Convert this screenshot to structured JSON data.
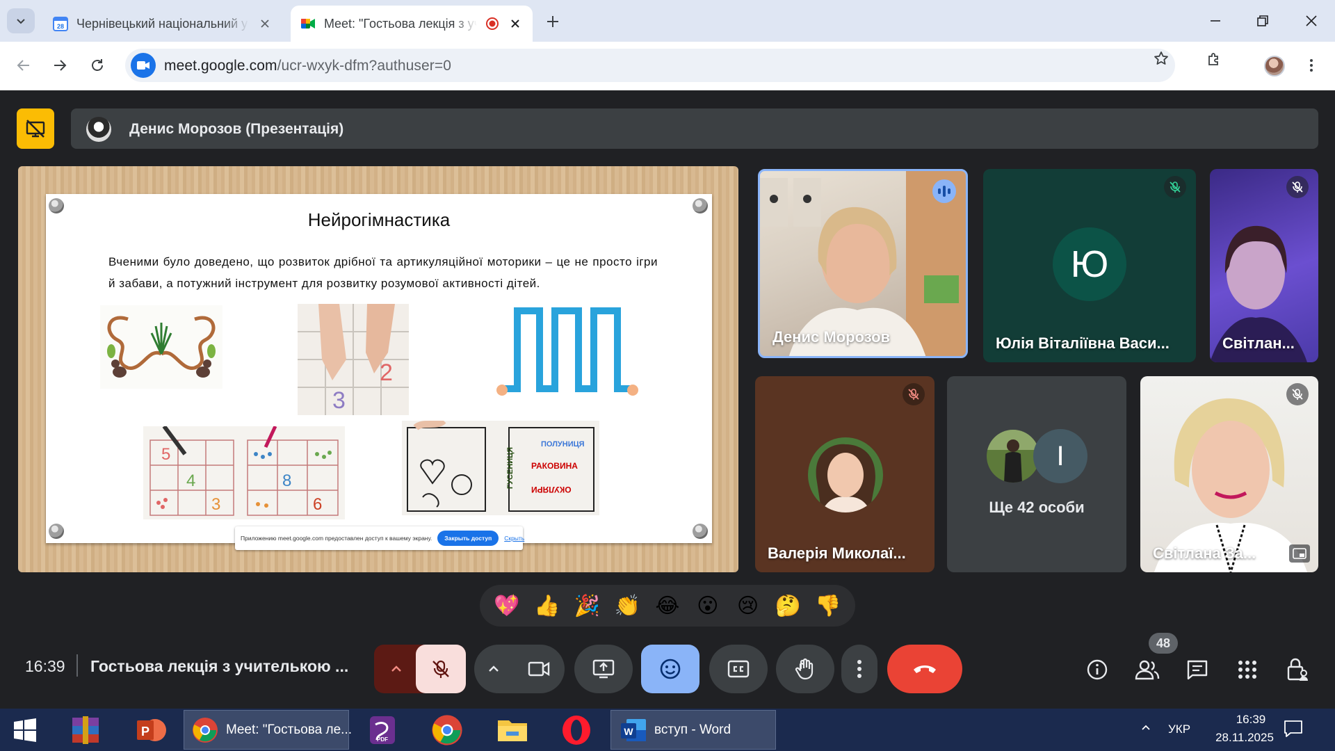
{
  "browser": {
    "tabs": [
      {
        "title": "Чернівецький національний у",
        "favicon": "calendar-icon",
        "active": false
      },
      {
        "title": "Meet: \"Гостьова лекція з уч",
        "favicon": "meet-icon",
        "active": true
      }
    ],
    "url_host": "meet.google.com",
    "url_path": "/ucr-wxyk-dfm?authuser=0"
  },
  "meet": {
    "presenter_banner": "Денис Морозов (Презентація)",
    "slide": {
      "title": "Нейрогімнастика",
      "body": "Вченими було доведено, що розвиток дрібної та артикуляційної моторики – це не просто ігри й забави, а потужний інструмент для розвитку розумової активності дітей.",
      "image_words": [
        "полуниця",
        "раковина",
        "окуляри",
        "гусениця"
      ],
      "consent_text": "Приложению meet.google.com предоставлен доступ к вашему экрану.",
      "consent_button": "Закрыть доступ",
      "consent_link": "Скрыть"
    },
    "participants": [
      {
        "name": "Денис Морозов",
        "speaking": true
      },
      {
        "name": "Юлія Віталіївна Васи...",
        "initial": "Ю",
        "muted": true
      },
      {
        "name": "Світлан...",
        "muted": true
      },
      {
        "name": "Валерія Миколаї...",
        "muted": true
      },
      {
        "name": "Ще 42 особи",
        "initial": "І"
      },
      {
        "name": "Світлана За...",
        "muted": true
      }
    ],
    "reactions": [
      "💖",
      "👍",
      "🎉",
      "👏",
      "😂",
      "😮",
      "😢",
      "🤔",
      "👎"
    ],
    "time": "16:39",
    "meeting_title": "Гостьова лекція з учителькою ...",
    "people_count": "48",
    "colors": {
      "leave": "#ea4335",
      "mic_off": "#f9dedc",
      "active_control": "#8ab4f8",
      "present_stop": "#fbbc04"
    }
  },
  "taskbar": {
    "items": [
      {
        "label": "Meet: \"Гостьова ле...",
        "icon": "chrome-icon"
      },
      {
        "label": "вступ - Word",
        "icon": "word-icon"
      }
    ],
    "language": "УКР",
    "time": "16:39",
    "date": "28.11.2025"
  }
}
